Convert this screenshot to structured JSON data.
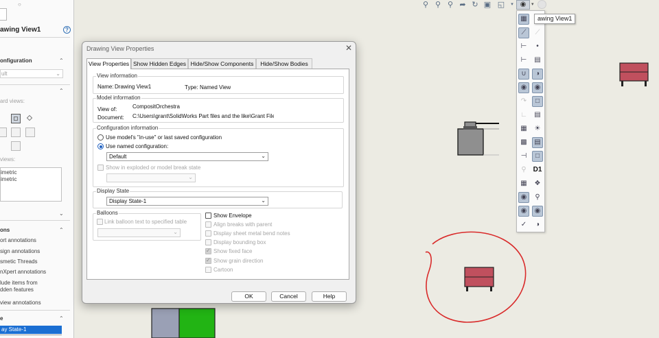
{
  "left_panel": {
    "title": "awing View1",
    "help_glyph": "?",
    "reference_configuration": {
      "header": "onfiguration",
      "value": "ult"
    },
    "orientation": {
      "standard_views_label": "ard views:",
      "more_views_label": "views:",
      "more_views_items": [
        "imetric",
        "imetric"
      ]
    },
    "annotations": {
      "header": "ons",
      "items": [
        "ort annotations",
        "sign annotations",
        "smetic Threads",
        "nXpert annotations",
        "lude items from",
        "dden features"
      ],
      "view_annotations": "view annotations"
    },
    "display_state": {
      "header": "e",
      "selected": "ay State-1"
    }
  },
  "graphics": {
    "tooltip": "awing View1",
    "flyout_label_d1": "D1"
  },
  "dialog": {
    "title": "Drawing View Properties",
    "close_glyph": "✕",
    "tabs": [
      "View Properties",
      "Show Hidden Edges",
      "Hide/Show Components",
      "Hide/Show Bodies"
    ],
    "view_information": {
      "header": "View information",
      "name_label": "Name:",
      "name_value": "Drawing View1",
      "type_label": "Type:",
      "type_value": "Named View"
    },
    "model_information": {
      "header": "Model information",
      "view_of_label": "View of:",
      "view_of_value": "CompositOrchestra",
      "document_label": "Document:",
      "document_value": "C:\\Users\\grant\\SolidWorks Part files and the like\\Grant Files"
    },
    "configuration_information": {
      "header": "Configuration information",
      "option_in_use": "Use model's \"in-use\" or last saved configuration",
      "option_named": "Use named configuration:",
      "named_value": "Default",
      "exploded_label": "Show in exploded or model break state",
      "exploded_value": ""
    },
    "display_state": {
      "header": "Display State",
      "value": "Display State-1"
    },
    "balloons": {
      "header": "Balloons",
      "link_label": "Link balloon text to specified table",
      "table_value": ""
    },
    "options": [
      {
        "label": "Show Envelope",
        "state": "unchecked"
      },
      {
        "label": "Align breaks with parent",
        "state": "disabled"
      },
      {
        "label": "Display sheet metal bend notes",
        "state": "disabled"
      },
      {
        "label": "Display bounding box",
        "state": "disabled"
      },
      {
        "label": "Show fixed face",
        "state": "disabled-checked"
      },
      {
        "label": "Show grain direction",
        "state": "disabled-checked"
      },
      {
        "label": "Cartoon",
        "state": "disabled"
      }
    ],
    "buttons": {
      "ok": "OK",
      "cancel": "Cancel",
      "help": "Help"
    }
  },
  "colors": {
    "canvas": "#ecebe3",
    "model_red": "#c0505e",
    "annotation_circle": "#d92a2a",
    "green_block": "#22b414",
    "selection_blue": "#1b6fd3"
  }
}
